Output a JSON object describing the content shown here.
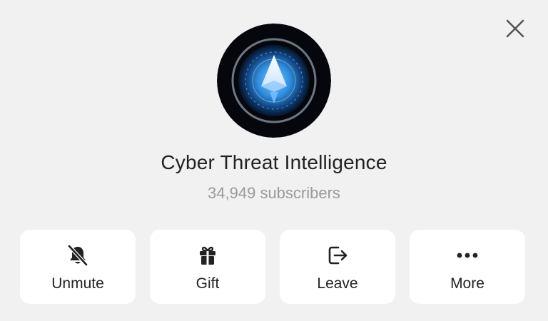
{
  "window": {
    "close_icon": "close-icon"
  },
  "channel": {
    "title": "Cyber Threat Intelligence",
    "subscribers": "34,949 subscribers",
    "avatar_icon": "channel-avatar-icon",
    "colors": {
      "avatar_bg": "#05070d",
      "avatar_glow": "#2f8fe0",
      "accent": "#4aa8ff"
    }
  },
  "actions": [
    {
      "label": "Unmute",
      "icon": "bell-muted-icon"
    },
    {
      "label": "Gift",
      "icon": "gift-icon"
    },
    {
      "label": "Leave",
      "icon": "leave-icon"
    },
    {
      "label": "More",
      "icon": "more-dots-icon"
    }
  ]
}
